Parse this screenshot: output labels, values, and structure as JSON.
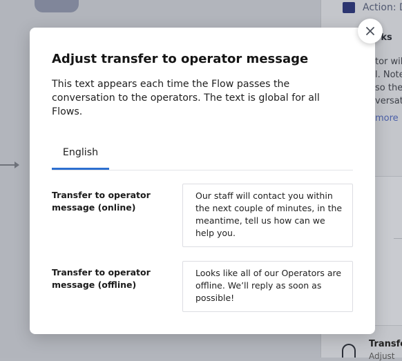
{
  "background": {
    "panel": {
      "action_text": "Action: D",
      "works_text": "rks",
      "text_lines": [
        "tor will",
        "l. Note",
        "so the",
        "versat"
      ],
      "more_link": "more",
      "transfer_title": "Transfe",
      "transfer_sub": "Adjust"
    }
  },
  "modal": {
    "title": "Adjust transfer to operator message",
    "description": "This text appears each time the Flow passes the conversation to the operators. The text is global for all Flows.",
    "tabs": [
      {
        "label": "English",
        "active": true
      }
    ],
    "fields": [
      {
        "label": "Transfer to operator message (online)",
        "value": "Our staff will contact you within the next couple of minutes, in the meantime, tell us how can we help you."
      },
      {
        "label": "Transfer to operator message (offline)",
        "value": "Looks like all of our Operators are offline. We’ll reply as soon as possible!"
      }
    ],
    "close_icon": "close-icon"
  },
  "colors": {
    "accent": "#2d6fd0",
    "overlay": "#b5b8bf",
    "modal_bg": "#ffffff"
  }
}
